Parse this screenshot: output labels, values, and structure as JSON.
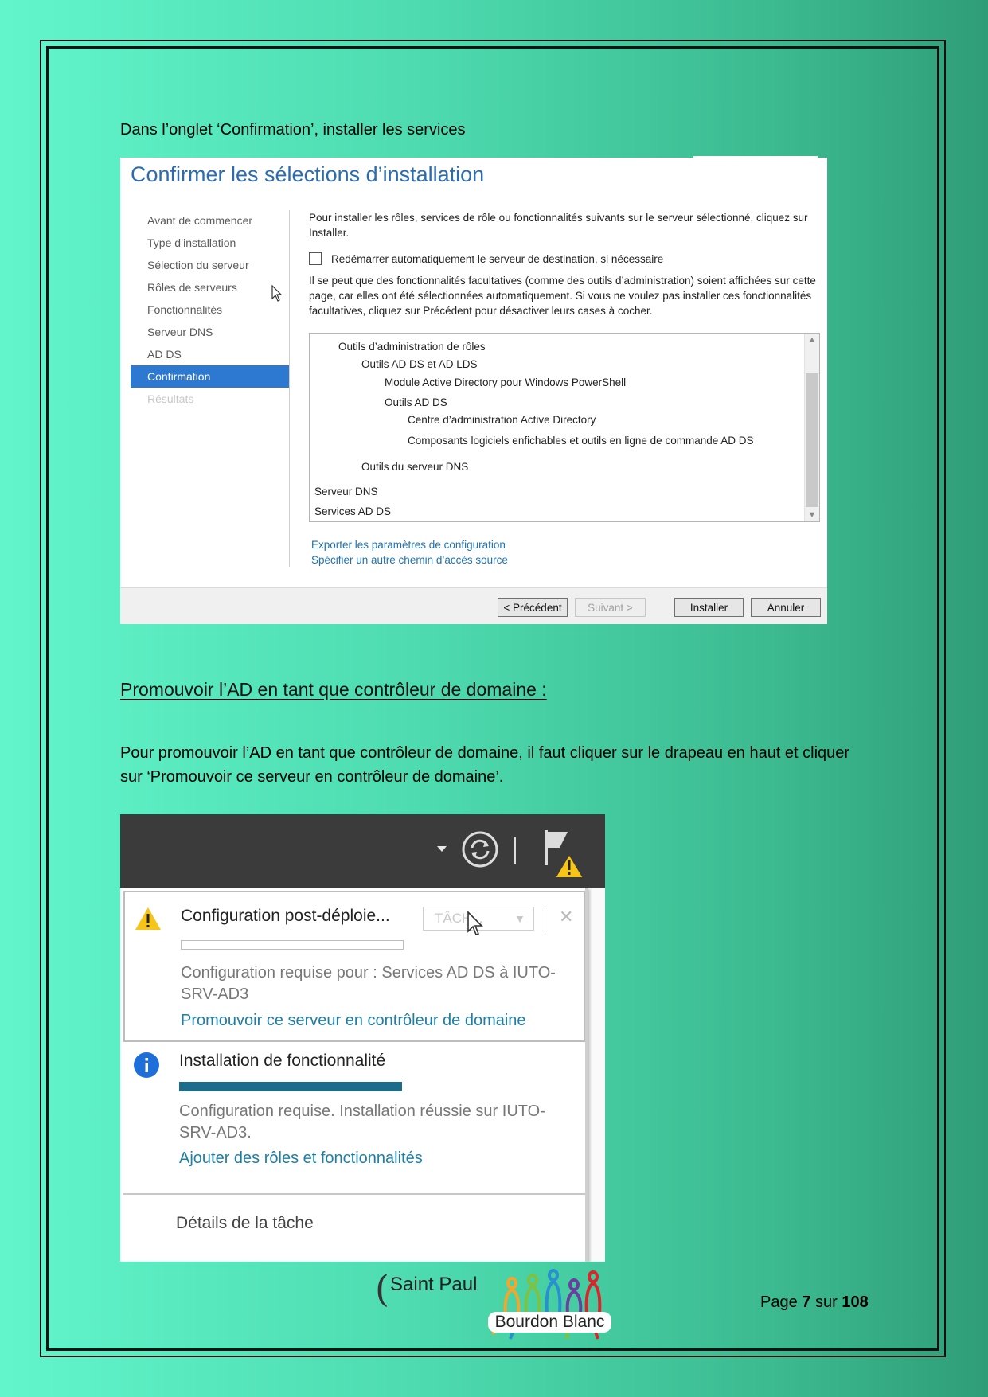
{
  "intro": "Dans l’onglet ‘Confirmation’, installer les services",
  "wizard": {
    "title": "Confirmer les sélections d’installation",
    "nav": [
      {
        "label": "Avant de commencer",
        "state": "normal"
      },
      {
        "label": "Type d’installation",
        "state": "normal"
      },
      {
        "label": "Sélection du serveur",
        "state": "normal"
      },
      {
        "label": "Rôles de serveurs",
        "state": "normal"
      },
      {
        "label": "Fonctionnalités",
        "state": "normal"
      },
      {
        "label": "Serveur DNS",
        "state": "normal"
      },
      {
        "label": "AD DS",
        "state": "normal"
      },
      {
        "label": "Confirmation",
        "state": "active"
      },
      {
        "label": "Résultats",
        "state": "disabled"
      }
    ],
    "description": "Pour installer les rôles, services de rôle ou fonctionnalités suivants sur le serveur sélectionné, cliquez sur Installer.",
    "restart_checkbox": {
      "label": "Redémarrer automatiquement le serveur de destination, si nécessaire",
      "checked": false
    },
    "note": "Il se peut que des fonctionnalités facultatives (comme des outils d’administration) soient affichées sur cette page, car elles ont été sélectionnées automatiquement. Si vous ne voulez pas installer ces fonctionnalités facultatives, cliquez sur Précédent pour désactiver leurs cases à cocher.",
    "selections": [
      {
        "text": "Outils d’administration de rôles",
        "level": 1
      },
      {
        "text": "Outils AD DS et AD LDS",
        "level": 2
      },
      {
        "text": "Module Active Directory pour Windows PowerShell",
        "level": 3
      },
      {
        "text": "Outils AD DS",
        "level": 3
      },
      {
        "text": "Centre d’administration Active Directory",
        "level": 4
      },
      {
        "text": "Composants logiciels enfichables et outils en ligne de commande AD DS",
        "level": 4
      },
      {
        "text": "Outils du serveur DNS",
        "level": 2
      },
      {
        "text": "Serveur DNS",
        "level": 0
      },
      {
        "text": "Services AD DS",
        "level": 0
      }
    ],
    "link_export": "Exporter les paramètres de configuration",
    "link_source": "Spécifier un autre chemin d’accès source",
    "buttons": {
      "previous": "< Précédent",
      "next": "Suivant >",
      "install": "Installer",
      "cancel": "Annuler"
    }
  },
  "heading": "Promouvoir l’AD en tant que contrôleur de domaine :",
  "paragraph": "Pour promouvoir l’AD en tant que contrôleur de domaine, il faut cliquer sur le drapeau en haut et cliquer sur ‘Promouvoir ce serveur en contrôleur de domaine’.",
  "notifications": {
    "icons": [
      "dropdown-arrow-icon",
      "refresh-icon",
      "flag-warning-icon"
    ],
    "items": [
      {
        "icon": "warning-icon",
        "title": "Configuration post-déploie...",
        "tasks_label": "TÂCH...",
        "progress": 0,
        "message": "Configuration requise pour : Services AD DS à IUTO-SRV-AD3",
        "link": "Promouvoir ce serveur en contrôleur de domaine"
      },
      {
        "icon": "info-icon",
        "title": "Installation de fonctionnalité",
        "progress": 1,
        "message": "Configuration requise. Installation réussie sur IUTO-SRV-AD3.",
        "link": "Ajouter des rôles et fonctionnalités"
      }
    ],
    "task_details": "Détails de la tâche",
    "colors": {
      "progress": "#1e6c8c",
      "link": "#1e7fa6",
      "warning": "#f5c518",
      "info": "#1e6fd9"
    }
  },
  "footer": {
    "brand": "Saint Paul",
    "logo_text": "Bourdon Blanc",
    "page_prefix": "Page",
    "page": "7",
    "page_mid": "sur",
    "total": "108"
  }
}
